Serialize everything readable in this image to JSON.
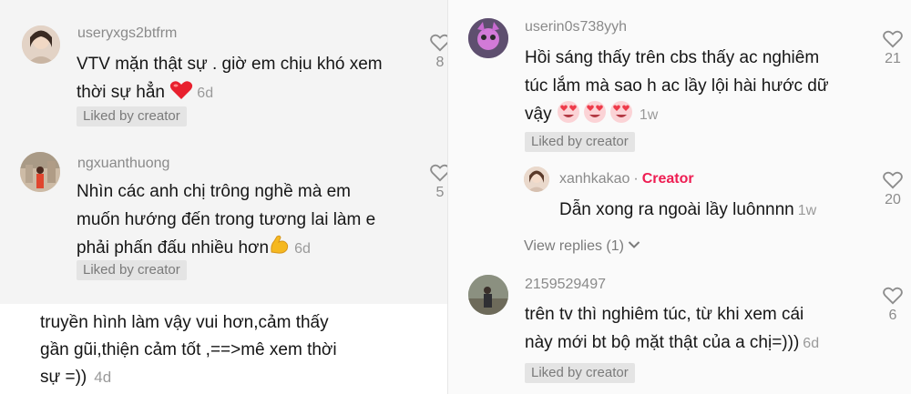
{
  "left": {
    "comment1": {
      "username": "useryxgs2btfrm",
      "line1": "VTV mặn thật sự . giờ em chịu khó xem",
      "line2": "thời sự hẳn",
      "time": "6d",
      "badge": "Liked by creator",
      "likes": "8"
    },
    "comment2": {
      "username": "ngxuanthuong",
      "line1": "Nhìn các anh chị trông nghề mà em",
      "line2": "muốn hướng đến trong tương lai làm e",
      "line3": "phải phấn đấu nhiều hơn",
      "time": "6d",
      "badge": "Liked by creator",
      "likes": "5"
    },
    "comment3": {
      "line1": "truyền hình làm vậy vui hơn,cảm thấy",
      "line2": "gần gũi,thiện cảm tốt ,==>mê xem thời",
      "line3": "sự =))",
      "time": "4d"
    }
  },
  "right": {
    "comment1": {
      "username": "userin0s738yyh",
      "line1": "Hồi sáng thấy trên cbs thấy ac nghiêm",
      "line2": "túc lắm mà sao h ac lầy lội hài hước dữ",
      "line3": "vậy",
      "time": "1w",
      "badge": "Liked by creator",
      "likes": "21"
    },
    "reply1": {
      "username": "xanhkakao",
      "creator_label": "Creator",
      "text": "Dẫn xong ra ngoài lầy luônnnn",
      "time": "1w",
      "likes": "20"
    },
    "view_replies": "View replies (1)",
    "comment2": {
      "username": "2159529497",
      "line1": "trên tv thì nghiêm túc, từ khi xem cái",
      "line2": "này mới bt bộ mặt thật của a chị=)))",
      "time": "6d",
      "badge": "Liked by creator",
      "likes": "6"
    }
  },
  "colors": {
    "creator": "#ee1d52",
    "heart_emoji": "#e8202e",
    "flex_emoji": "#f5b820"
  },
  "icons": [
    "heart-outline-icon",
    "red-heart-emoji",
    "flexed-biceps-emoji",
    "heart-eyes-emoji",
    "chevron-down-icon"
  ]
}
